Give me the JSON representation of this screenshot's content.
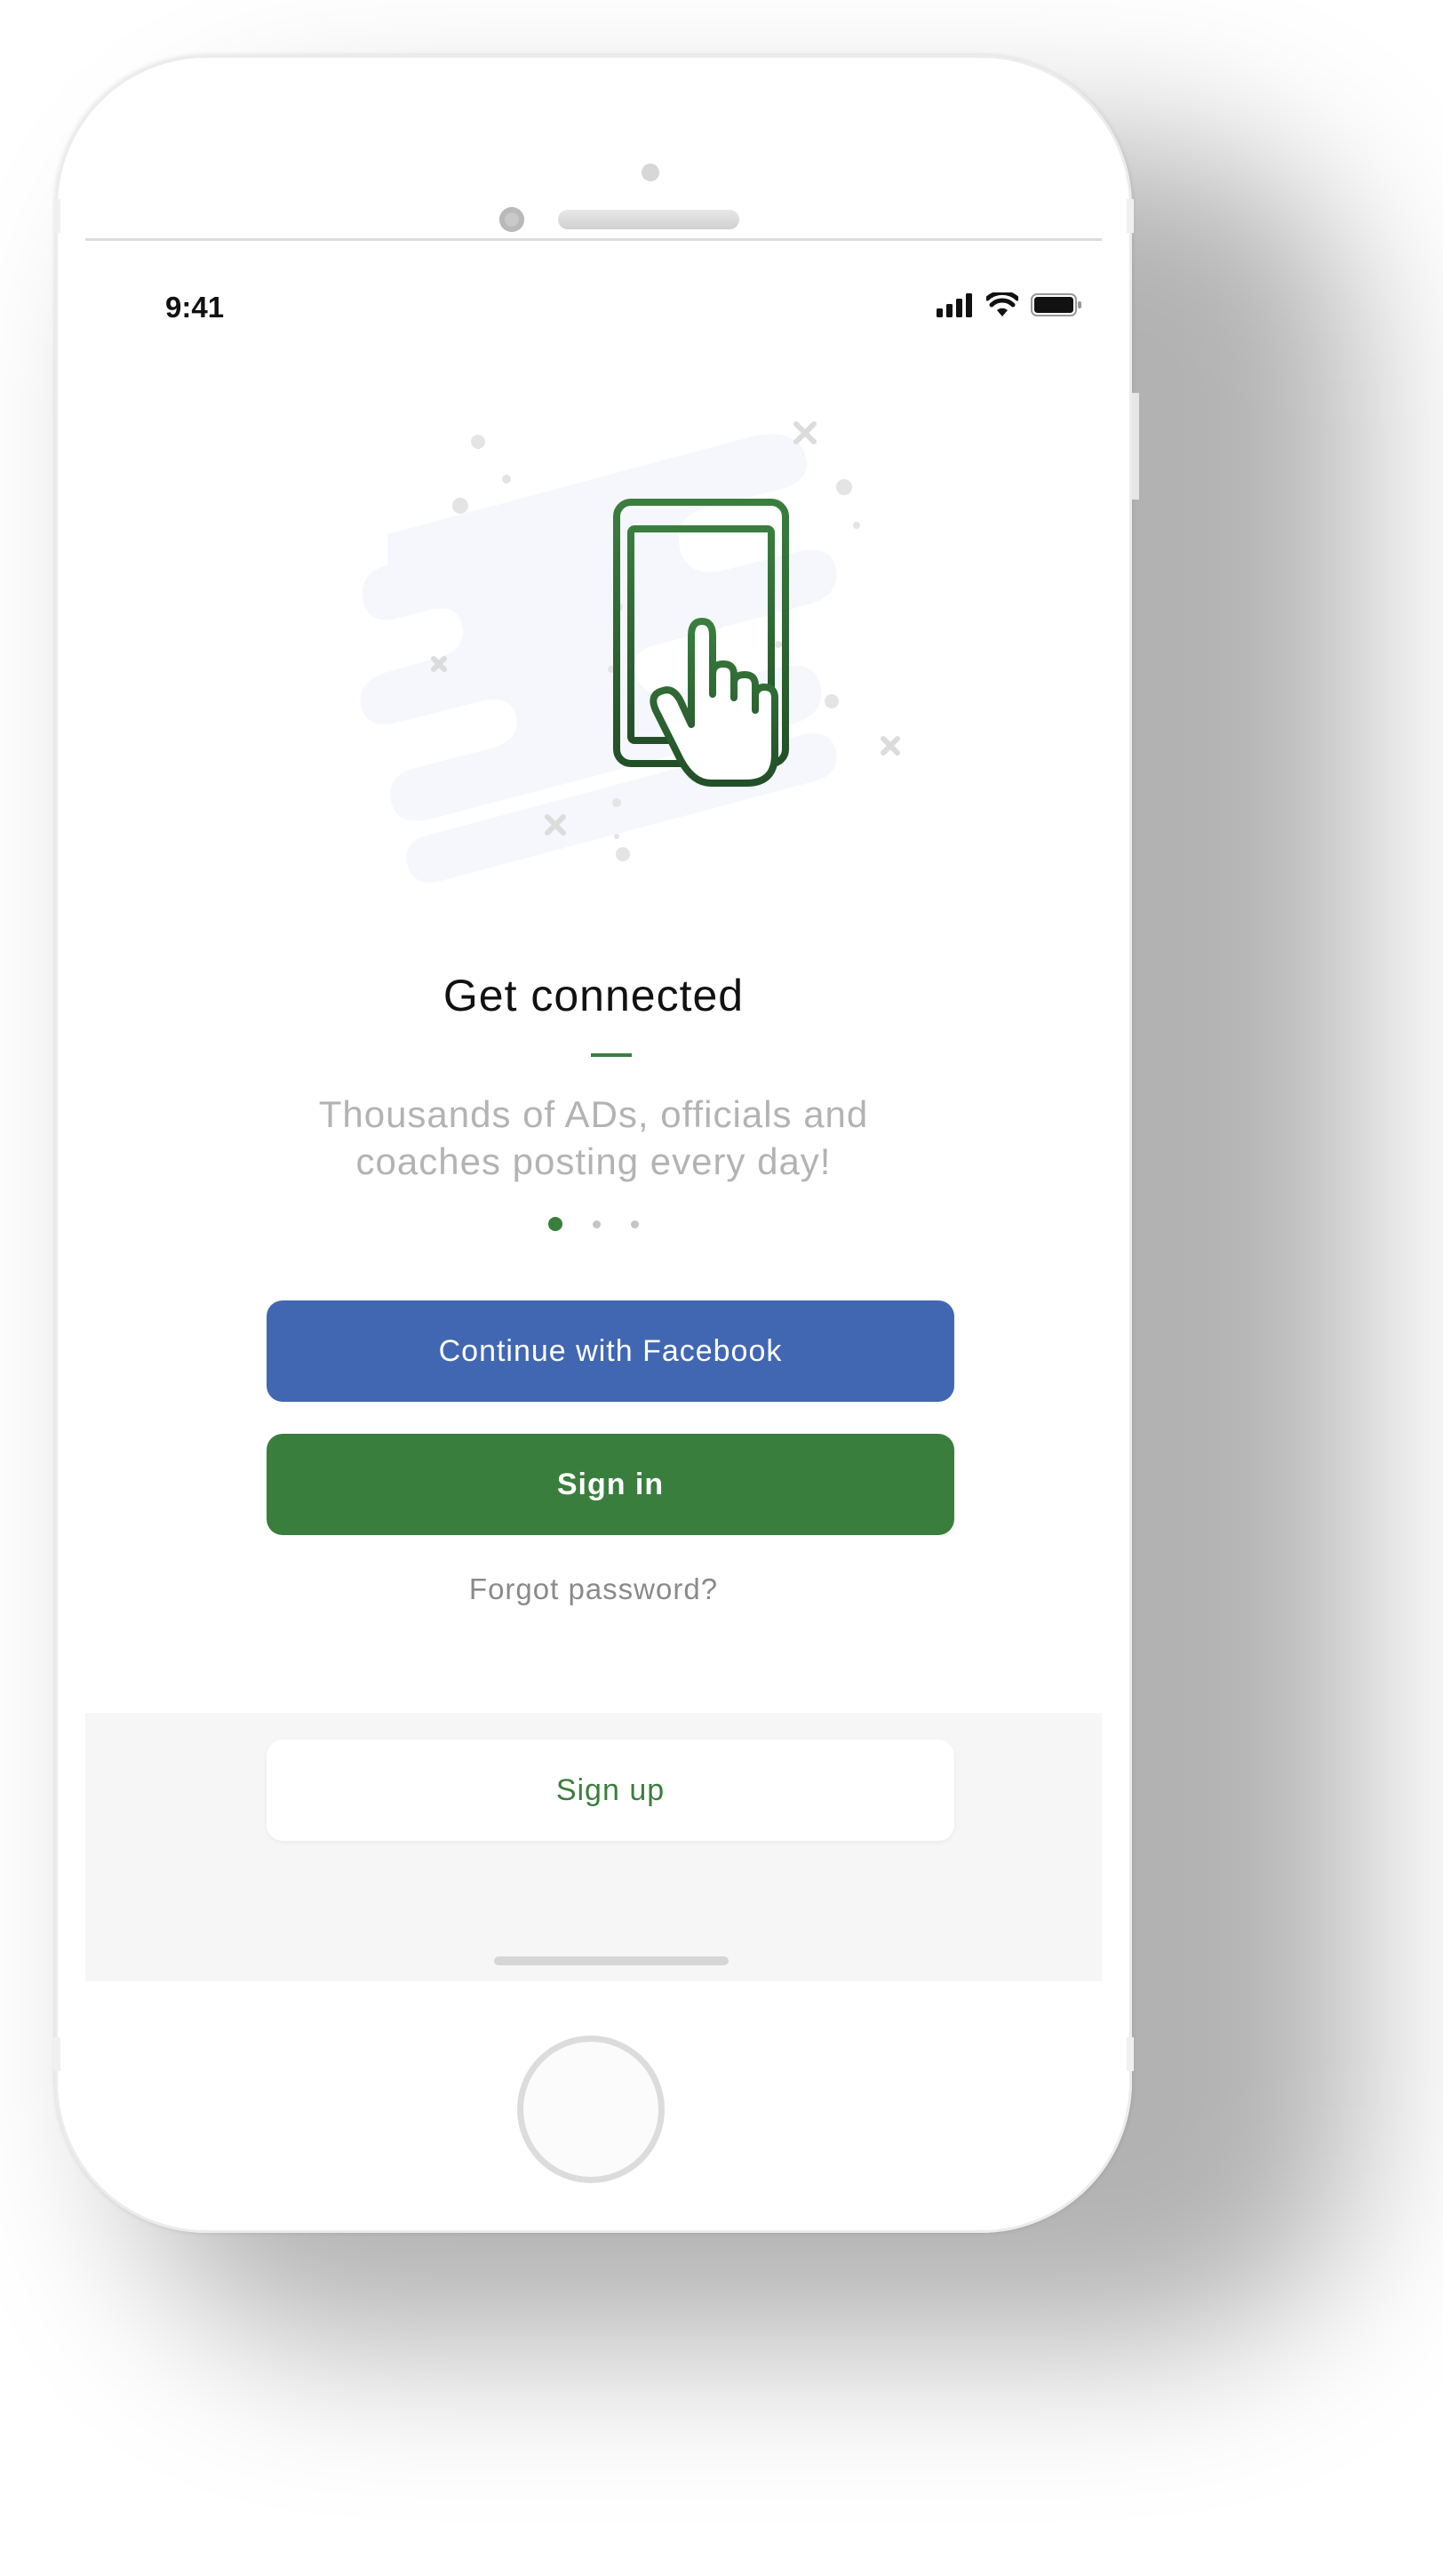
{
  "status_bar": {
    "time": "9:41",
    "icons": [
      "signal-icon",
      "wifi-icon",
      "battery-icon"
    ]
  },
  "onboarding": {
    "illustration": "tap-phone-icon",
    "title": "Get connected",
    "subtitle": "Thousands of ADs, officials and coaches posting every day!",
    "pagination": {
      "total": 3,
      "current": 1
    }
  },
  "actions": {
    "facebook_label": "Continue with Facebook",
    "signin_label": "Sign in",
    "forgot_label": "Forgot password?"
  },
  "footer": {
    "signup_label": "Sign up"
  },
  "colors": {
    "accent": "#3a7e3e",
    "facebook": "#4167b2",
    "muted_text": "#b3b3b3",
    "footer_bg": "#f6f6f6"
  }
}
